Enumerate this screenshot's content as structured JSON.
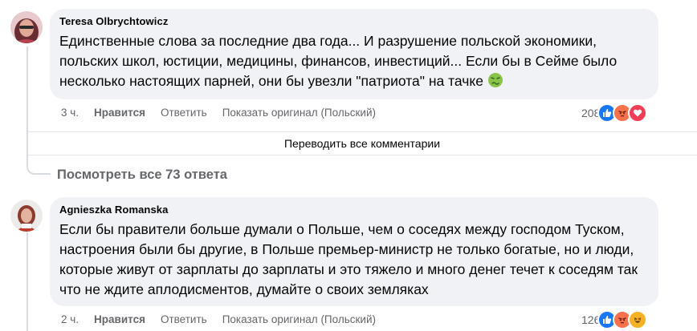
{
  "comments": [
    {
      "author": "Teresa Olbrychtowicz",
      "text": "Единственные слова за последние два года... И разрушение польской экономики, польских школ, юстиции, медицины, финансов, инвестиций... Если бы в Сейме было несколько настоящих парней, они бы увезли \"патриота\" на тачке",
      "emoji": "nauseated-face-emoji",
      "time": "3 ч.",
      "like_label": "Нравится",
      "reply_label": "Ответить",
      "show_original_label": "Показать оригинал (Польский)",
      "reaction_count": "208",
      "reactions": [
        "like-icon",
        "angry-icon",
        "love-icon"
      ]
    },
    {
      "author": "Agnieszka Romanska",
      "text": "Если бы правители больше думали о Польше, чем о соседях между господом Туском, настроения были бы другие, в Польше премьер-министр не только богатые, но и люди, которые живут от зарплаты до зарплаты и это тяжело и много денег течет к соседям так что не ждите аплодисментов, думайте о своих земляках",
      "time": "2 ч.",
      "like_label": "Нравится",
      "reply_label": "Ответить",
      "show_original_label": "Показать оригинал (Польский)",
      "reaction_count": "126",
      "reactions": [
        "like-icon",
        "angry-icon",
        "haha-icon"
      ]
    }
  ],
  "translate_all_label": "Переводить все комментарии",
  "view_replies_label": "Посмотреть все 73 ответа",
  "colors": {
    "bubble": "#f0f2f5",
    "secondary_text": "#65676b",
    "like_blue": "#1877f2",
    "angry_orange": "#f7714c",
    "love_red": "#f33e58",
    "haha_yellow": "#f7b125"
  }
}
